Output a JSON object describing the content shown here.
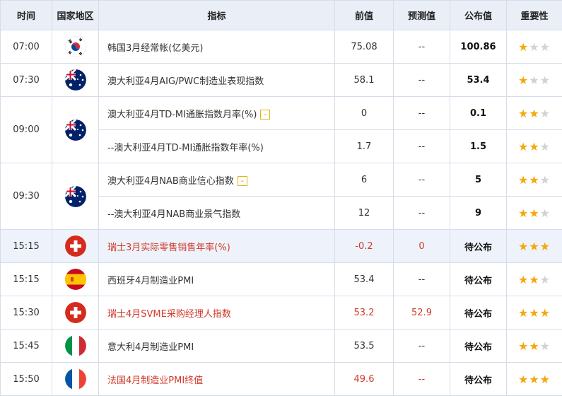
{
  "headers": {
    "time": "时间",
    "country": "国家地区",
    "indicator": "指标",
    "prev": "前值",
    "forecast": "预测值",
    "actual": "公布值",
    "importance": "重要性"
  },
  "icons": {
    "star": "star-icon",
    "expand": "expand-icon",
    "flags": [
      "korea-flag-icon",
      "australia-flag-icon",
      "switzerland-flag-icon",
      "spain-flag-icon",
      "italy-flag-icon",
      "france-flag-icon"
    ]
  },
  "colors": {
    "highlight_text": "#d0382a",
    "star_on": "#f4a80b",
    "star_off": "#d2d2d2",
    "header_bg": "#e9eef7"
  },
  "badge_symbol": "-",
  "rows": [
    {
      "time": "07:00",
      "indicator": "韩国3月经常帐(亿美元)",
      "prev": "75.08",
      "forecast": "--",
      "actual": "100.86",
      "stars": 1
    },
    {
      "time": "07:30",
      "indicator": "澳大利亚4月AIG/PWC制造业表现指数",
      "prev": "58.1",
      "forecast": "--",
      "actual": "53.4",
      "stars": 1
    },
    {
      "time": "09:00",
      "indicator": "澳大利亚4月TD-MI通胀指数月率(%)",
      "prev": "0",
      "forecast": "--",
      "actual": "0.1",
      "stars": 2
    },
    {
      "indicator": "--澳大利亚4月TD-MI通胀指数年率(%)",
      "prev": "1.7",
      "forecast": "--",
      "actual": "1.5",
      "stars": 2
    },
    {
      "time": "09:30",
      "indicator": "澳大利亚4月NAB商业信心指数",
      "prev": "6",
      "forecast": "--",
      "actual": "5",
      "stars": 2
    },
    {
      "indicator": "--澳大利亚4月NAB商业景气指数",
      "prev": "12",
      "forecast": "--",
      "actual": "9",
      "stars": 2
    },
    {
      "time": "15:15",
      "indicator": "瑞士3月实际零售销售年率(%)",
      "prev": "-0.2",
      "forecast": "0",
      "actual": "待公布",
      "stars": 3
    },
    {
      "time": "15:15",
      "indicator": "西班牙4月制造业PMI",
      "prev": "53.4",
      "forecast": "--",
      "actual": "待公布",
      "stars": 2
    },
    {
      "time": "15:30",
      "indicator": "瑞士4月SVME采购经理人指数",
      "prev": "53.2",
      "forecast": "52.9",
      "actual": "待公布",
      "stars": 3
    },
    {
      "time": "15:45",
      "indicator": "意大利4月制造业PMI",
      "prev": "53.5",
      "forecast": "--",
      "actual": "待公布",
      "stars": 2
    },
    {
      "time": "15:50",
      "indicator": "法国4月制造业PMI终值",
      "prev": "49.6",
      "forecast": "--",
      "actual": "待公布",
      "stars": 3
    }
  ]
}
